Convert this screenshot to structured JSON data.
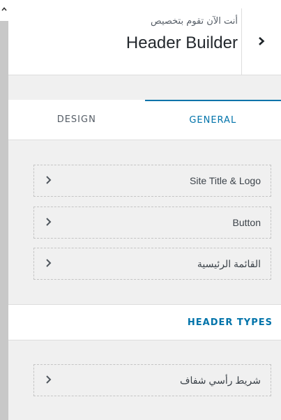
{
  "header": {
    "subtitle": "أنت الآن تقوم بتخصيص",
    "title": "Header Builder"
  },
  "tabs": [
    {
      "label": "DESIGN",
      "active": false
    },
    {
      "label": "GENERAL",
      "active": true
    }
  ],
  "items": [
    {
      "label": "Site Title & Logo"
    },
    {
      "label": "Button"
    },
    {
      "label": "القائمة الرئيسية"
    }
  ],
  "section": {
    "title": "HEADER TYPES",
    "items": [
      {
        "label": "شريط رأسي شفاف"
      }
    ]
  },
  "icons": {
    "back": "chevron-right-icon",
    "item": "chevron-right-icon",
    "scroll": "chevron-up-icon"
  },
  "colors": {
    "accent": "#0073aa",
    "panel_bg": "#f0f0f0",
    "text": "#23282d"
  }
}
